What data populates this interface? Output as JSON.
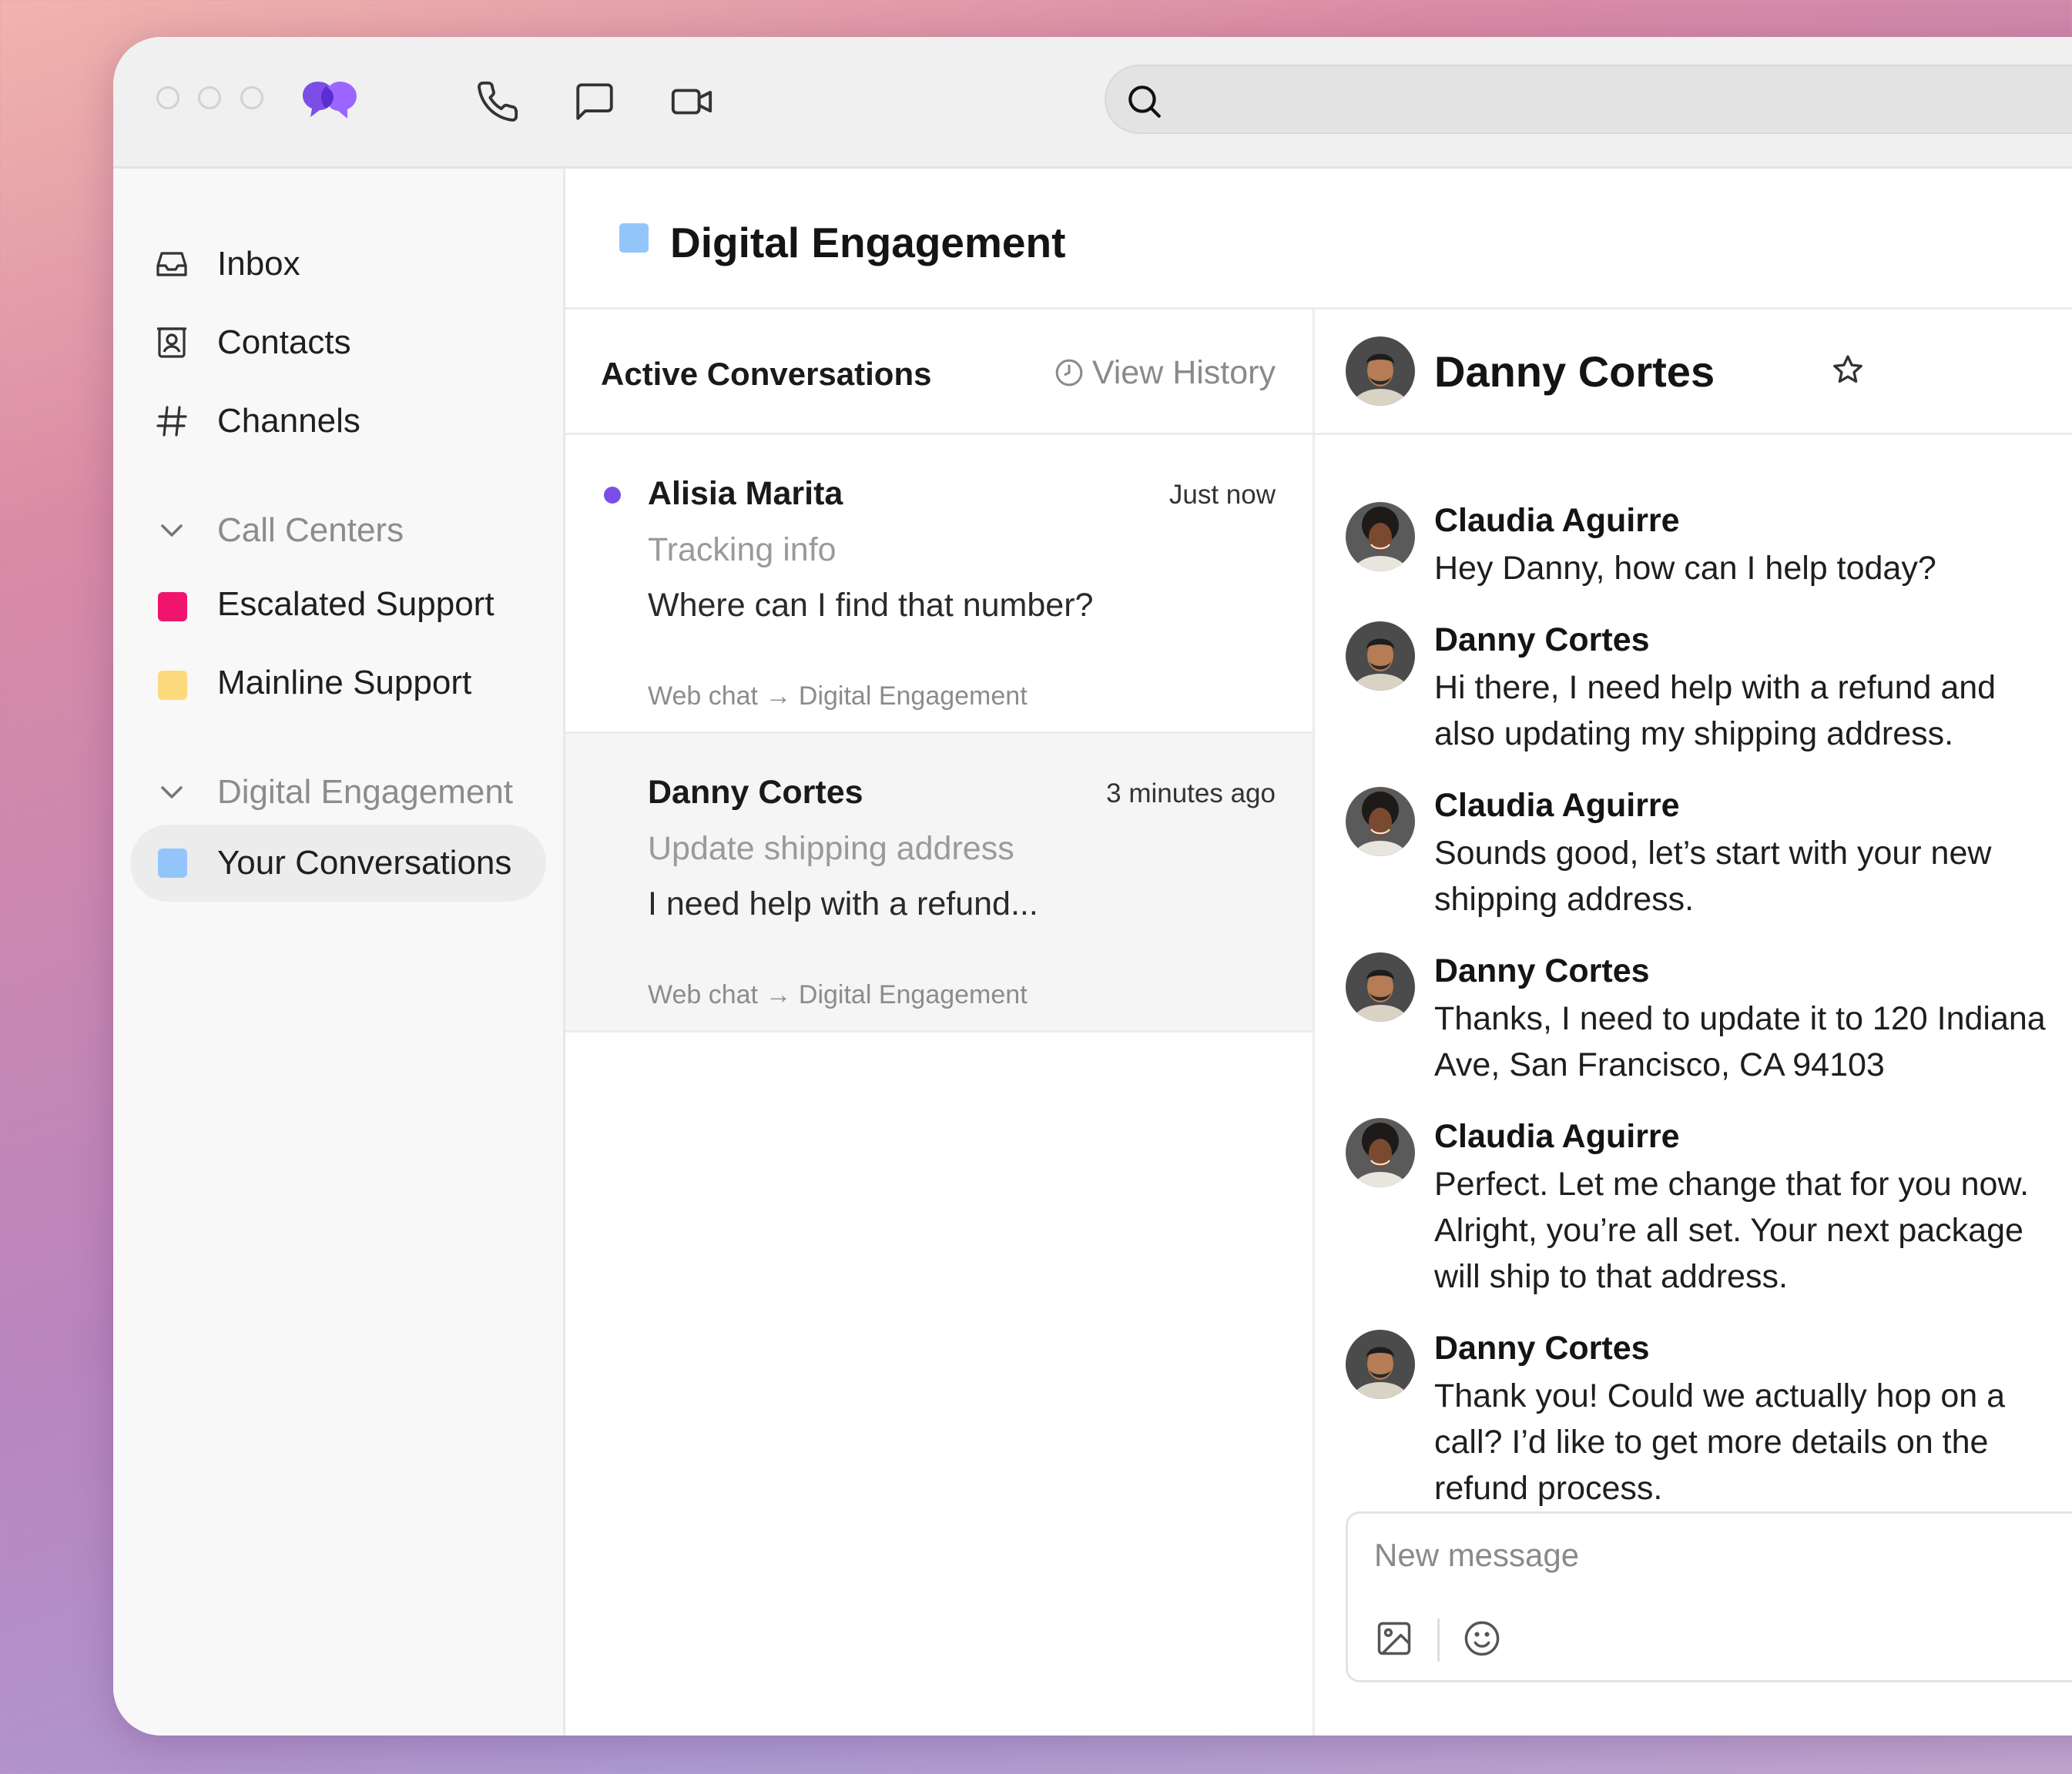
{
  "window": {
    "controls": [
      "close",
      "minimize",
      "zoom"
    ],
    "logo_icon": "purple-speech-bubbles-logo",
    "toolbar_icons": [
      "phone-icon",
      "chat-icon",
      "video-icon"
    ],
    "search": {
      "icon": "search-icon",
      "value": ""
    }
  },
  "sidebar": {
    "items": [
      {
        "label": "Inbox",
        "icon": "inbox-icon"
      },
      {
        "label": "Contacts",
        "icon": "contacts-icon"
      },
      {
        "label": "Channels",
        "icon": "hash-icon"
      }
    ],
    "groups": [
      {
        "label": "Call Centers",
        "icon": "chevron-down-icon",
        "items": [
          {
            "label": "Escalated Support",
            "color": "#f0146e"
          },
          {
            "label": "Mainline Support",
            "color": "#fcd97b"
          }
        ]
      },
      {
        "label": "Digital Engagement",
        "icon": "chevron-down-icon",
        "items": [
          {
            "label": "Your Conversations",
            "color": "#93c5fb",
            "active": true
          }
        ]
      }
    ]
  },
  "main": {
    "title": "Digital Engagement",
    "title_color": "#93c5fb"
  },
  "conversations": {
    "header": "Active Conversations",
    "view_history": "View History",
    "items": [
      {
        "name": "Alisia Marita",
        "time": "Just now",
        "subject": "Tracking info",
        "preview": "Where can I find that number?",
        "route": "Web chat → Digital Engagement",
        "unread": true
      },
      {
        "name": "Danny Cortes",
        "time": "3 minutes ago",
        "subject": "Update shipping address",
        "preview": "I need help with a refund...",
        "route": "Web chat → Digital Engagement",
        "selected": true
      }
    ]
  },
  "chat": {
    "contact_name": "Danny Cortes",
    "star_icon": "star-outline-icon",
    "messages": [
      {
        "sender": "Claudia Aguirre",
        "text": "Hey Danny, how can I help today?"
      },
      {
        "sender": "Danny Cortes",
        "text": "Hi there, I need help with a refund and also updating my shipping address."
      },
      {
        "sender": "Claudia Aguirre",
        "text": "Sounds good, let’s start with your new shipping address."
      },
      {
        "sender": "Danny Cortes",
        "text": "Thanks, I need to update it to 120 Indiana Ave, San Francisco, CA 94103"
      },
      {
        "sender": "Claudia Aguirre",
        "text": "Perfect. Let me change that for you now. Alright, you’re all set. Your next package will ship to that address."
      },
      {
        "sender": "Danny Cortes",
        "text": "Thank you! Could we actually hop on a call? I’d like to get more details on the refund process."
      }
    ],
    "composer": {
      "placeholder": "New message",
      "icons": [
        "image-icon",
        "emoji-icon"
      ]
    }
  },
  "colors": {
    "accent": "#7b4fe6",
    "unread_dot": "#7b4fe6"
  }
}
